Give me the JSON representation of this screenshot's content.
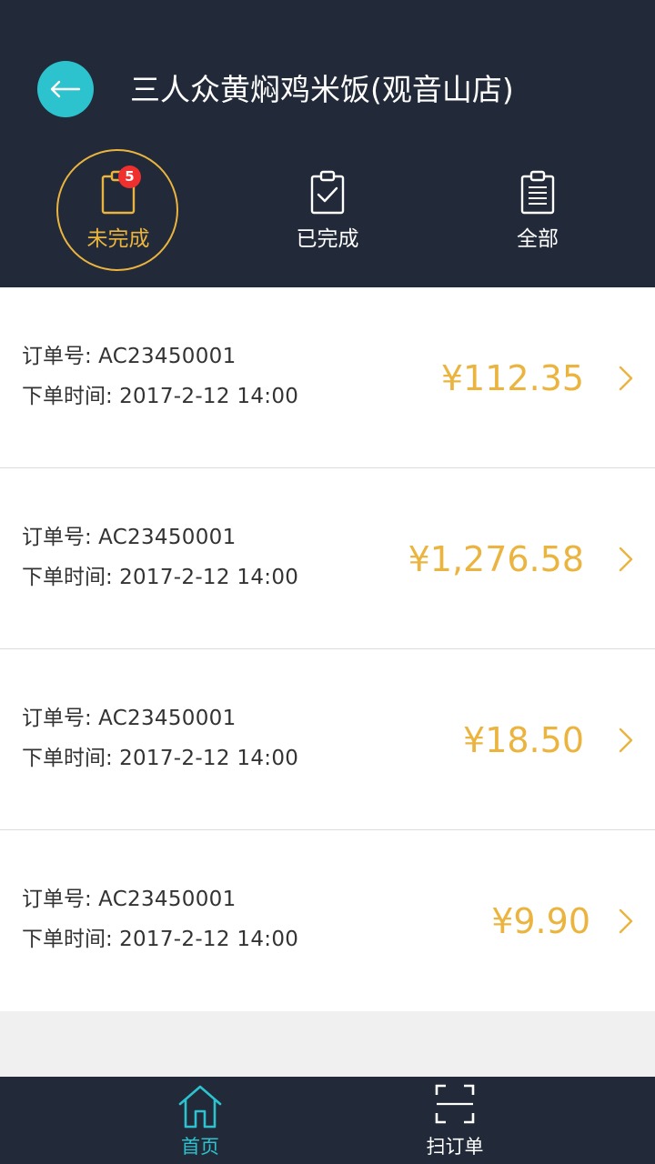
{
  "header": {
    "store_title": "三人众黄焖鸡米饭(观音山店)",
    "tabs": [
      {
        "label": "未完成",
        "badge": "5",
        "active": true
      },
      {
        "label": "已完成",
        "active": false
      },
      {
        "label": "全部",
        "active": false
      }
    ]
  },
  "orders": [
    {
      "no_label": "订单号:",
      "no": "AC23450001",
      "time_label": "下单时间:",
      "time": "2017-2-12 14:00",
      "amount": "¥112.35"
    },
    {
      "no_label": "订单号:",
      "no": "AC23450001",
      "time_label": "下单时间:",
      "time": "2017-2-12 14:00",
      "amount": "¥1,276.58"
    },
    {
      "no_label": "订单号:",
      "no": "AC23450001",
      "time_label": "下单时间:",
      "time": "2017-2-12 14:00",
      "amount": "¥18.50"
    },
    {
      "no_label": "订单号:",
      "no": "AC23450001",
      "time_label": "下单时间:",
      "time": "2017-2-12 14:00",
      "amount": "¥9.90"
    }
  ],
  "bottom_nav": [
    {
      "label": "首页",
      "icon": "home-icon",
      "active": true
    },
    {
      "label": "扫订单",
      "icon": "scan-icon",
      "active": false
    }
  ],
  "colors": {
    "header_bg": "#222a3a",
    "accent_teal": "#2cc3cf",
    "accent_gold": "#eab43e",
    "badge_red": "#f0302f"
  }
}
